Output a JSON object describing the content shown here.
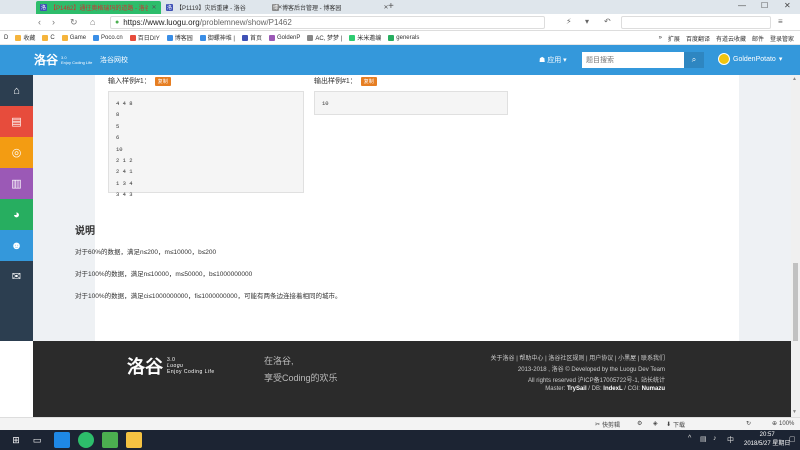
{
  "browser": {
    "tabs": [
      {
        "title": "【P1462】通往奥格瑞玛的道路 - 洛谷",
        "favicon": "luogu",
        "active": true
      },
      {
        "title": "【P1119】灾后重建 - 洛谷",
        "favicon": "luogu",
        "active": false
      },
      {
        "title": "博客后台管理 - 博客园",
        "favicon": "cnblogs",
        "active": false
      }
    ],
    "new_tab": "+",
    "window_controls": [
      "—",
      "☐",
      "✕"
    ],
    "url_host": "https://www.luogu.org",
    "url_path": "/problemnew/show/P1462",
    "bookmarks": [
      {
        "label": "D"
      },
      {
        "label": "收藏"
      },
      {
        "label": "C"
      },
      {
        "label": "Game"
      },
      {
        "label": "Poco.cn"
      },
      {
        "label": "百日DIY"
      },
      {
        "label": "博客园"
      },
      {
        "label": "御螺神堆 |"
      },
      {
        "label": "首页"
      },
      {
        "label": "GoldenP"
      },
      {
        "label": "AC, 梦梦 |"
      },
      {
        "label": "米米邀编"
      },
      {
        "label": "generals"
      }
    ],
    "bookmarks_right": [
      "扩展",
      "百度翻译",
      "有道云收藏",
      "邮件",
      "登录管家"
    ],
    "bookmark_overflow": "»"
  },
  "site": {
    "logo_text": "洛谷",
    "logo_sub": "Enjoy Coding Life",
    "logo_version": "3.0",
    "nav_school": "洛谷网校",
    "nav_app": "应用",
    "search_placeholder": "题目搜索",
    "username": "GoldenPotato"
  },
  "problem": {
    "input_title": "输入样例#1：",
    "output_title": "输出样例#1：",
    "copy_label": "复制",
    "input_sample": "4 4 8\n8\n5\n6\n10\n2 1 2\n2 4 1\n1 3 4\n3 4 3",
    "output_sample": "10",
    "desc_title": "说明",
    "desc_lines": [
      "对于60%的数据，满足n≤200，m≤10000，b≤200",
      "对于100%的数据，满足n≤10000，m≤50000，b≤1000000000",
      "对于100%的数据，满足ci≤1000000000，fi≤1000000000，可能有两条边连接着相同的城市。"
    ]
  },
  "footer": {
    "logo_text": "洛谷",
    "logo_version": "3.0",
    "logo_brand": "Luogu",
    "logo_sub": "Enjoy Coding Life",
    "slogan_1": "在洛谷,",
    "slogan_2": "享受Coding的欢乐",
    "links": "关于洛谷 | 帮助中心 | 洛谷社区规则 | 用户协议 | 小黑屋 | 联系我们",
    "copyright": "2013-2018 , 洛谷 © Developed by the Luogu Dev Team",
    "rights": "All rights reserved 沪ICP备17005722号-1, 站长统计",
    "master_label": "Master: ",
    "master": "TrySail",
    "db_label": " / DB: ",
    "db": "IndexL",
    "cgi_label": " / CGI: ",
    "cgi": "Numazu"
  },
  "statusbar": {
    "quick_cut": "快剪辑",
    "download": "下载",
    "zoom": "100%"
  },
  "taskbar": {
    "time": "20:57",
    "date": "2018/5/27 星期日",
    "lang": "中"
  }
}
